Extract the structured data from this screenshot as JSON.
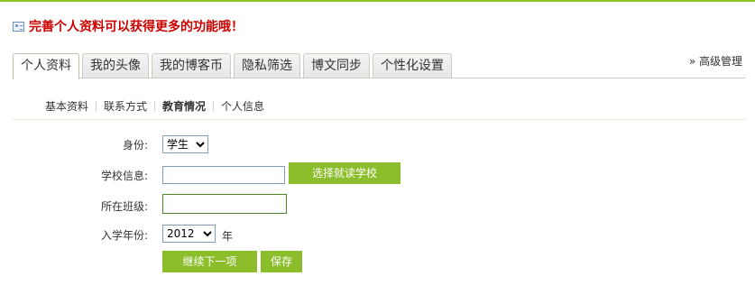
{
  "notice": {
    "text": "完善个人资料可以获得更多的功能哦！"
  },
  "tabs": [
    {
      "label": "个人资料"
    },
    {
      "label": "我的头像"
    },
    {
      "label": "我的博客币"
    },
    {
      "label": "隐私筛选"
    },
    {
      "label": "博文同步"
    },
    {
      "label": "个性化设置"
    }
  ],
  "advanced_link": "» 高级管理",
  "subnav": [
    {
      "label": "基本资料"
    },
    {
      "label": "联系方式"
    },
    {
      "label": "教育情况"
    },
    {
      "label": "个人信息"
    }
  ],
  "form": {
    "identity_label": "身份:",
    "identity_value": "学生",
    "school_label": "学校信息:",
    "school_value": "",
    "choose_school_button": "选择就读学校",
    "class_label": "所在班级:",
    "class_value": "",
    "year_label": "入学年份:",
    "year_value": "2012",
    "year_unit": "年",
    "next_button": "继续下一项",
    "save_button": "保存"
  },
  "colors": {
    "accent": "#8cbd2a",
    "notice": "#cc0000",
    "top_line": "#8fc31f"
  }
}
